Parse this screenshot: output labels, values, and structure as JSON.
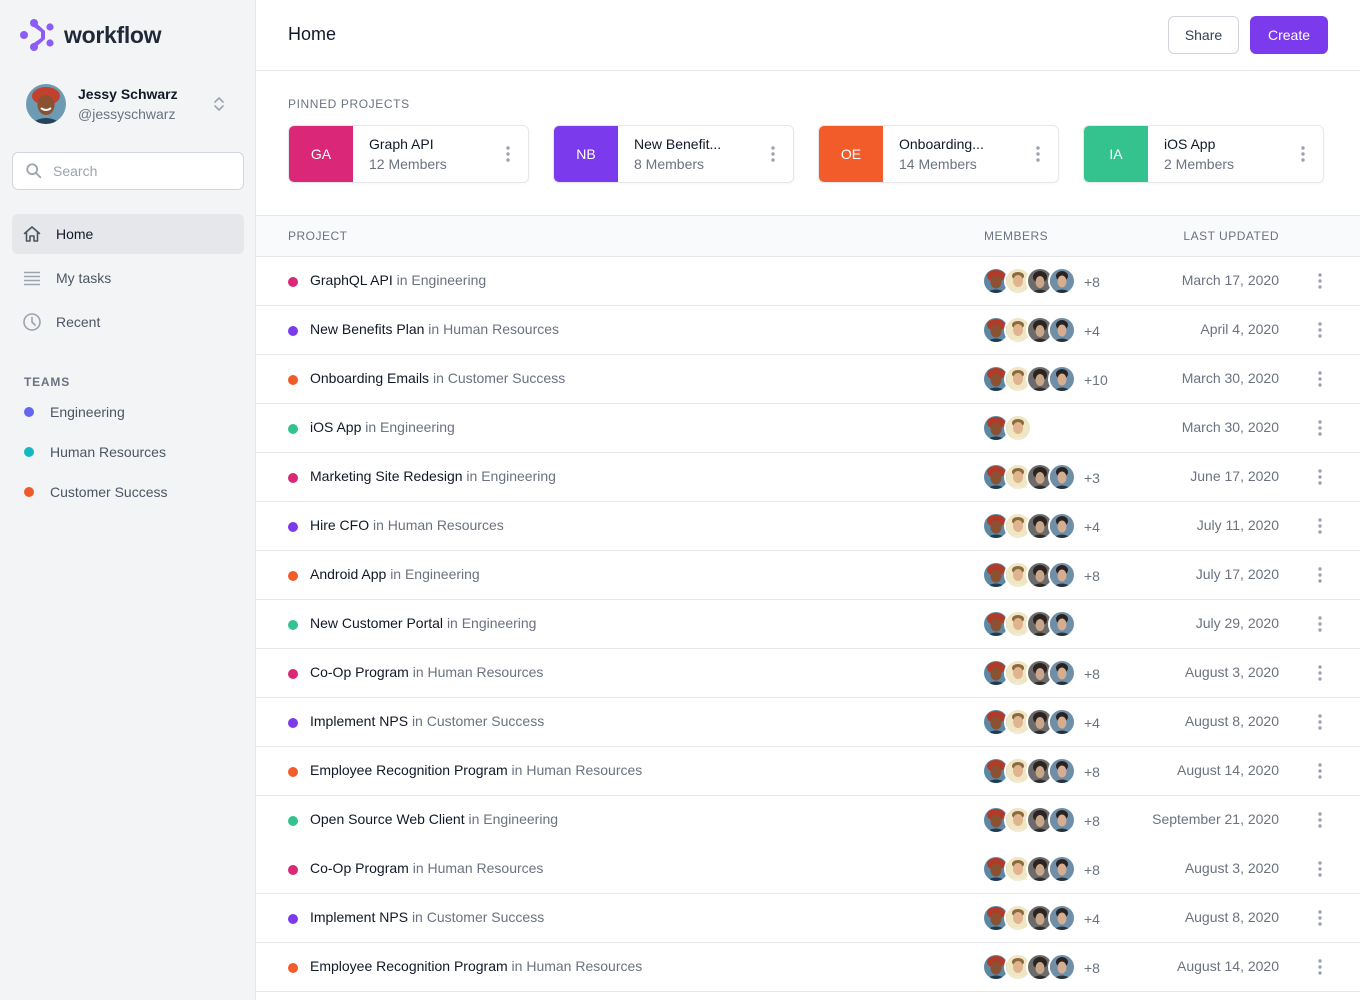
{
  "app": {
    "name": "workflow",
    "brand_color": "#7c3aed"
  },
  "user": {
    "name": "Jessy Schwarz",
    "handle": "@jessyschwarz"
  },
  "search": {
    "placeholder": "Search",
    "value": ""
  },
  "nav": [
    {
      "label": "Home",
      "icon": "home-icon",
      "active": true
    },
    {
      "label": "My tasks",
      "icon": "list-icon",
      "active": false
    },
    {
      "label": "Recent",
      "icon": "clock-icon",
      "active": false
    }
  ],
  "teams": {
    "label": "TEAMS",
    "items": [
      {
        "label": "Engineering",
        "color": "#6366f1"
      },
      {
        "label": "Human Resources",
        "color": "#14b8c4"
      },
      {
        "label": "Customer Success",
        "color": "#f05a28"
      }
    ]
  },
  "header": {
    "title": "Home",
    "share_label": "Share",
    "create_label": "Create"
  },
  "pinned": {
    "label": "PINNED PROJECTS",
    "items": [
      {
        "initials": "GA",
        "name": "Graph API",
        "members": "12 Members",
        "color": "#db2777"
      },
      {
        "initials": "NB",
        "name": "New Benefit...",
        "members": "8 Members",
        "color": "#7c3aed"
      },
      {
        "initials": "OE",
        "name": "Onboarding...",
        "members": "14 Members",
        "color": "#f25c2a"
      },
      {
        "initials": "IA",
        "name": "iOS App",
        "members": "2 Members",
        "color": "#34c28e"
      }
    ]
  },
  "table": {
    "headers": {
      "project": "PROJECT",
      "members": "MEMBERS",
      "updated": "LAST UPDATED"
    },
    "rows": [
      {
        "name": "GraphQL API",
        "team": "in Engineering",
        "color": "#db2777",
        "avatars": 4,
        "more": "+8",
        "updated": "March 17, 2020"
      },
      {
        "name": "New Benefits Plan",
        "team": "in Human Resources",
        "color": "#7c3aed",
        "avatars": 4,
        "more": "+4",
        "updated": "April 4, 2020"
      },
      {
        "name": "Onboarding Emails",
        "team": "in Customer Success",
        "color": "#f25c2a",
        "avatars": 4,
        "more": "+10",
        "updated": "March 30, 2020"
      },
      {
        "name": "iOS App",
        "team": "in Engineering",
        "color": "#34c28e",
        "avatars": 2,
        "more": "",
        "updated": "March 30, 2020"
      },
      {
        "name": "Marketing Site Redesign",
        "team": "in Engineering",
        "color": "#db2777",
        "avatars": 4,
        "more": "+3",
        "updated": "June 17, 2020"
      },
      {
        "name": "Hire CFO",
        "team": "in Human Resources",
        "color": "#7c3aed",
        "avatars": 4,
        "more": "+4",
        "updated": "July 11, 2020"
      },
      {
        "name": "Android App",
        "team": "in Engineering",
        "color": "#f25c2a",
        "avatars": 4,
        "more": "+8",
        "updated": "July 17, 2020"
      },
      {
        "name": "New Customer Portal",
        "team": "in Engineering",
        "color": "#34c28e",
        "avatars": 4,
        "more": "",
        "updated": "July 29, 2020"
      },
      {
        "name": "Co-Op Program",
        "team": "in Human Resources",
        "color": "#db2777",
        "avatars": 4,
        "more": "+8",
        "updated": "August 3, 2020"
      },
      {
        "name": "Implement NPS",
        "team": "in Customer Success",
        "color": "#7c3aed",
        "avatars": 4,
        "more": "+4",
        "updated": "August 8, 2020"
      },
      {
        "name": "Employee Recognition Program",
        "team": "in Human Resources",
        "color": "#f25c2a",
        "avatars": 4,
        "more": "+8",
        "updated": "August 14, 2020"
      },
      {
        "name": "Open Source Web Client",
        "team": "in Engineering",
        "color": "#34c28e",
        "avatars": 4,
        "more": "+8",
        "updated": "September 21, 2020",
        "no_border": true
      },
      {
        "name": "Co-Op Program",
        "team": "in Human Resources",
        "color": "#db2777",
        "avatars": 4,
        "more": "+8",
        "updated": "August 3, 2020"
      },
      {
        "name": "Implement NPS",
        "team": "in Customer Success",
        "color": "#7c3aed",
        "avatars": 4,
        "more": "+4",
        "updated": "August 8, 2020"
      },
      {
        "name": "Employee Recognition Program",
        "team": "in Human Resources",
        "color": "#f25c2a",
        "avatars": 4,
        "more": "+8",
        "updated": "August 14, 2020"
      }
    ]
  }
}
